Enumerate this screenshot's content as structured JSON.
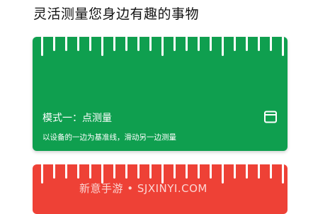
{
  "headline": "灵活测量您身边有趣的事物",
  "mode_card": {
    "title": "模式一：点测量",
    "description": "以设备的一边为基准线，滑动另一边测量",
    "icon": "fullscreen-frame-icon",
    "color": "#0f9f4f"
  },
  "next_card": {
    "color": "#ee4136"
  },
  "watermark": "新意手游 • SJXINYI.COM"
}
